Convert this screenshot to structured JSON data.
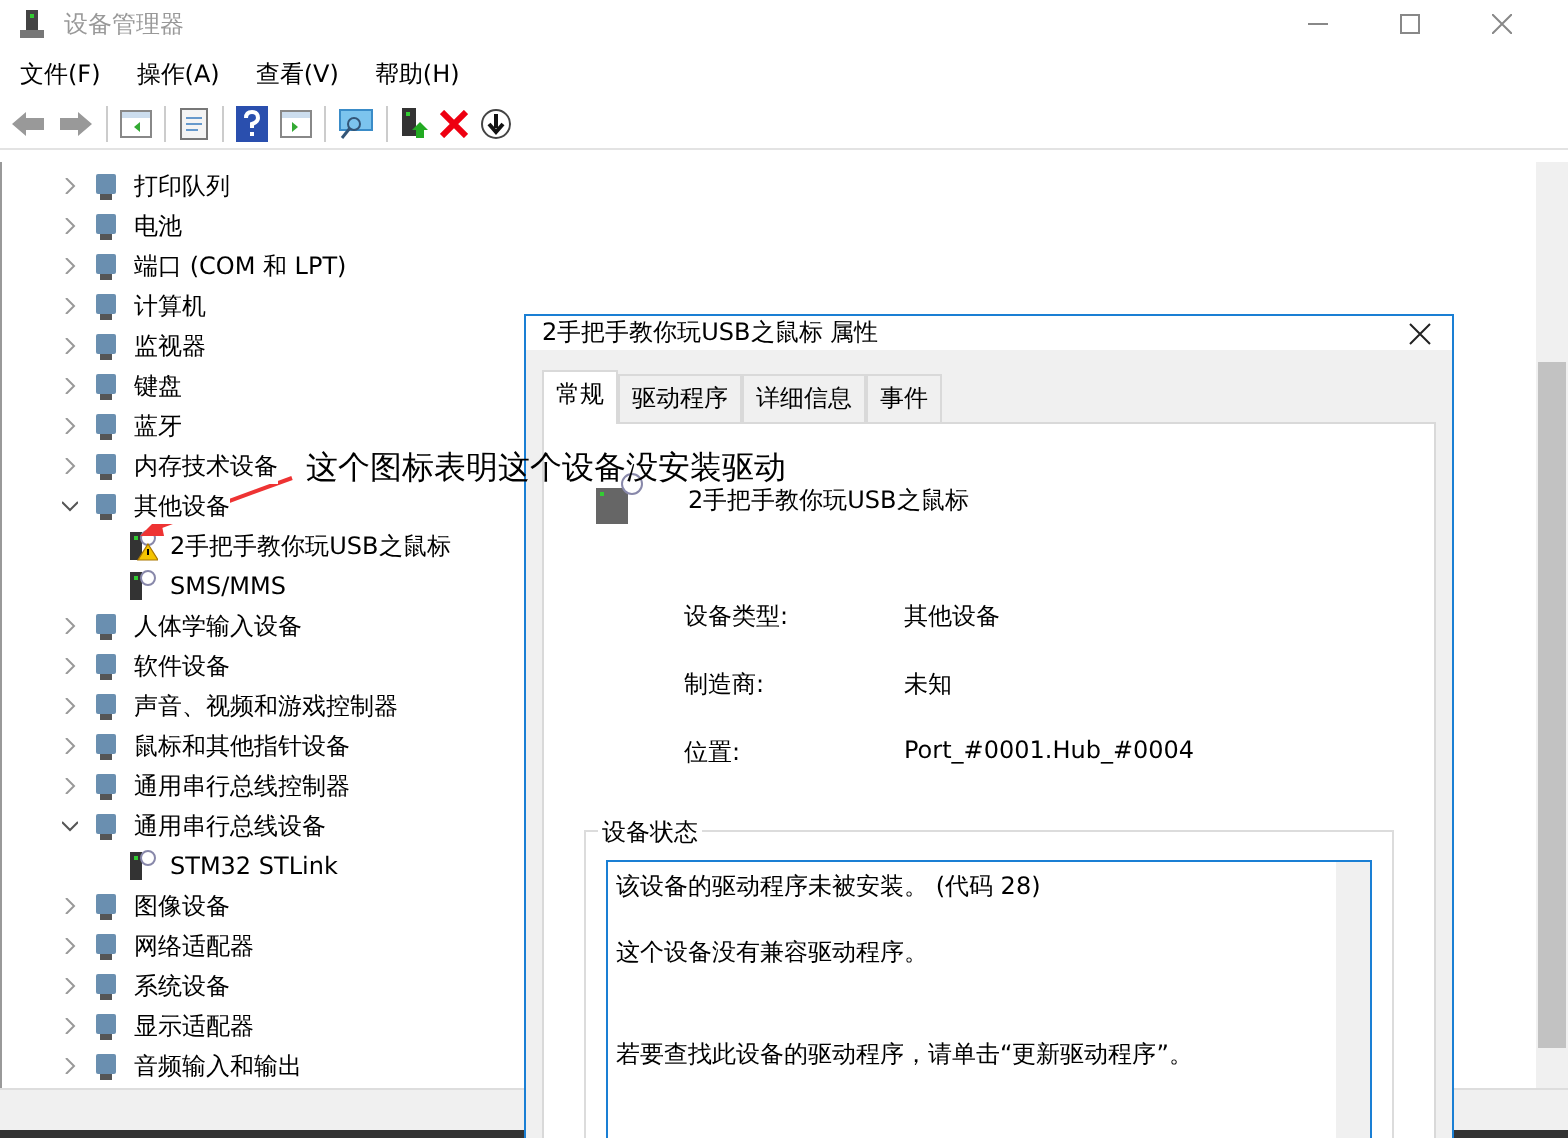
{
  "window": {
    "title": "设备管理器"
  },
  "menu": [
    "文件(F)",
    "操作(A)",
    "查看(V)",
    "帮助(H)"
  ],
  "tree": [
    {
      "label": "打印队列",
      "expanded": false
    },
    {
      "label": "电池",
      "expanded": false
    },
    {
      "label": "端口 (COM 和 LPT)",
      "expanded": false
    },
    {
      "label": "计算机",
      "expanded": false
    },
    {
      "label": "监视器",
      "expanded": false
    },
    {
      "label": "键盘",
      "expanded": false
    },
    {
      "label": "蓝牙",
      "expanded": false
    },
    {
      "label": "内存技术设备",
      "expanded": false
    },
    {
      "label": "其他设备",
      "expanded": true,
      "children": [
        {
          "label": "2手把手教你玩USB之鼠标",
          "warning": true
        },
        {
          "label": "SMS/MMS",
          "warning": false
        }
      ]
    },
    {
      "label": "人体学输入设备",
      "expanded": false
    },
    {
      "label": "软件设备",
      "expanded": false
    },
    {
      "label": "声音、视频和游戏控制器",
      "expanded": false
    },
    {
      "label": "鼠标和其他指针设备",
      "expanded": false
    },
    {
      "label": "通用串行总线控制器",
      "expanded": false
    },
    {
      "label": "通用串行总线设备",
      "expanded": true,
      "children": [
        {
          "label": "STM32 STLink",
          "warning": false
        }
      ]
    },
    {
      "label": "图像设备",
      "expanded": false
    },
    {
      "label": "网络适配器",
      "expanded": false
    },
    {
      "label": "系统设备",
      "expanded": false
    },
    {
      "label": "显示适配器",
      "expanded": false
    },
    {
      "label": "音频输入和输出",
      "expanded": false
    }
  ],
  "annotation": "这个图标表明这个设备没安装驱动",
  "dialog": {
    "title": "2手把手教你玩USB之鼠标 属性",
    "tabs": [
      {
        "label": "常规",
        "selected": true
      },
      {
        "label": "驱动程序",
        "selected": false
      },
      {
        "label": "详细信息",
        "selected": false
      },
      {
        "label": "事件",
        "selected": false
      }
    ],
    "device_name": "2手把手教你玩USB之鼠标",
    "fields": [
      {
        "label": "设备类型:",
        "value": "其他设备"
      },
      {
        "label": "制造商:",
        "value": "未知"
      },
      {
        "label": "位置:",
        "value": "Port_#0001.Hub_#0004"
      }
    ],
    "status_group": "设备状态",
    "status_lines": [
      "该设备的驱动程序未被安装。 (代码 28)",
      "这个设备没有兼容驱动程序。",
      "若要查找此设备的驱动程序，请单击“更新驱动程序”。"
    ]
  }
}
